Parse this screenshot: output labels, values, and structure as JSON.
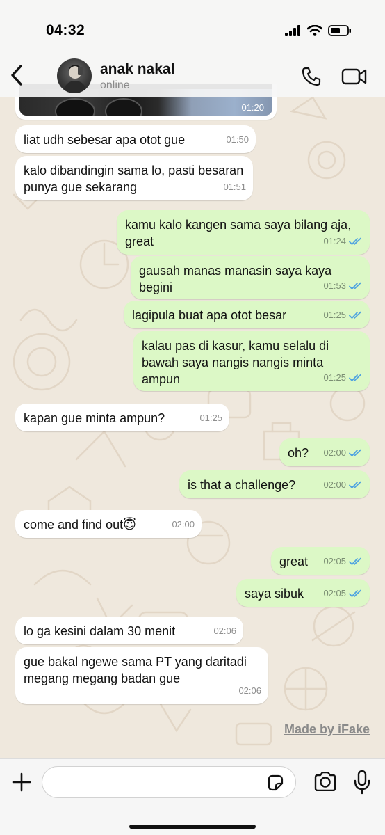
{
  "status_bar": {
    "time": "04:32"
  },
  "header": {
    "contact_name": "anak nakal",
    "contact_status": "online",
    "icons": {
      "back": "chevron-left-icon",
      "call": "phone-icon",
      "video": "video-camera-icon"
    }
  },
  "media_message": {
    "time": "01:20"
  },
  "messages": [
    {
      "direction": "in",
      "text": "liat udh sebesar apa otot gue",
      "time": "01:50"
    },
    {
      "direction": "in",
      "text": "kalo dibandingin sama lo, pasti besaran punya gue sekarang",
      "time": "01:51"
    },
    {
      "direction": "out",
      "text": "kamu kalo kangen sama saya bilang aja, great",
      "time": "01:24",
      "read": true
    },
    {
      "direction": "out",
      "text": "gausah manas manasin saya kaya begini",
      "time": "01:53",
      "read": true
    },
    {
      "direction": "out",
      "text": "lagipula buat apa otot besar",
      "time": "01:25",
      "read": true
    },
    {
      "direction": "out",
      "text": "kalau pas di kasur, kamu selalu di bawah saya nangis nangis minta ampun",
      "time": "01:25",
      "read": true
    },
    {
      "direction": "in",
      "text": "kapan gue minta ampun?",
      "time": "01:25"
    },
    {
      "direction": "out",
      "text": "oh?",
      "time": "02:00",
      "read": true
    },
    {
      "direction": "out",
      "text": "is that a challenge?",
      "time": "02:00",
      "read": true
    },
    {
      "direction": "in",
      "text": "come and find out😇",
      "time": "02:00"
    },
    {
      "direction": "out",
      "text": "great",
      "time": "02:05",
      "read": true
    },
    {
      "direction": "out",
      "text": "saya sibuk",
      "time": "02:05",
      "read": true
    },
    {
      "direction": "in",
      "text": "lo ga kesini dalam 30 menit",
      "time": "02:06"
    },
    {
      "direction": "in",
      "text": "gue bakal ngewe sama PT yang daritadi megang megang badan gue",
      "time": "02:06"
    }
  ],
  "watermark": "Made by iFake",
  "composer": {
    "value": "",
    "icons": {
      "attach": "plus-icon",
      "sticker": "sticker-icon",
      "camera": "camera-icon",
      "mic": "microphone-icon"
    }
  },
  "colors": {
    "incoming_bubble": "#ffffff",
    "outgoing_bubble": "#dcf8c6",
    "read_ticks": "#4fa3e0",
    "wallpaper": "#efe8dd"
  }
}
